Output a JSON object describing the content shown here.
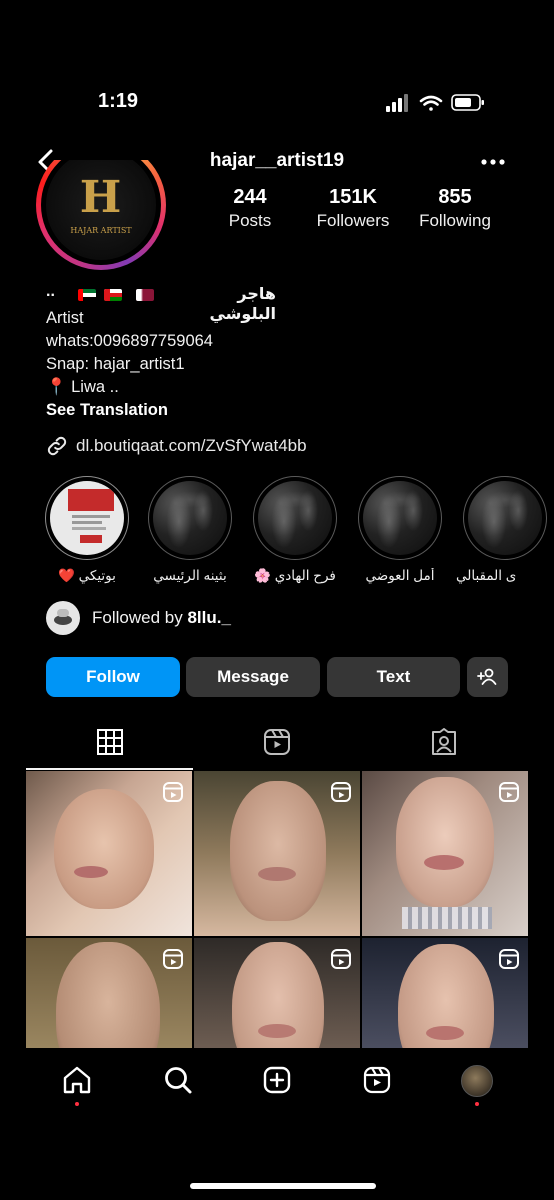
{
  "status_bar": {
    "time": "1:19"
  },
  "header": {
    "username": "hajar__artist19"
  },
  "avatar": {
    "logo_letter": "H",
    "logo_text": "HAJAR ARTIST"
  },
  "stats": {
    "posts": {
      "value": "244",
      "label": "Posts"
    },
    "followers": {
      "value": "151K",
      "label": "Followers"
    },
    "following": {
      "value": "855",
      "label": "Following"
    }
  },
  "bio": {
    "dots": "..",
    "name": "هاجر البلوشي",
    "lines": [
      "Artist",
      "whats:0096897759064",
      "Snap: hajar_artist1",
      "📍 Liwa .."
    ],
    "see_translation": "See Translation",
    "link": "dl.boutiqaat.com/ZvSfYwat4bb"
  },
  "highlights": [
    {
      "label": "بوتيكي ❤️"
    },
    {
      "label": "بثينه الرئيسي"
    },
    {
      "label": "فرح الهادي 🌸"
    },
    {
      "label": "أمل العوضي"
    },
    {
      "label": "ى المقبالي"
    }
  ],
  "followed_by": {
    "prefix": "Followed by ",
    "user": "8llu._"
  },
  "buttons": {
    "follow": "Follow",
    "message": "Message",
    "text": "Text"
  },
  "icons": {
    "back": "chevron-left-icon",
    "more": "more-horizontal-icon",
    "link": "link-icon",
    "add_user": "add-person-icon",
    "grid": "grid-icon",
    "reels": "reels-icon",
    "tagged": "tagged-icon",
    "home": "home-icon",
    "search": "search-icon",
    "create": "plus-square-icon",
    "profile": "profile-avatar-icon"
  },
  "colors": {
    "follow_blue": "#0095f6",
    "notification_dot": "#ff3040",
    "logo_gold": "#c9a04a"
  }
}
